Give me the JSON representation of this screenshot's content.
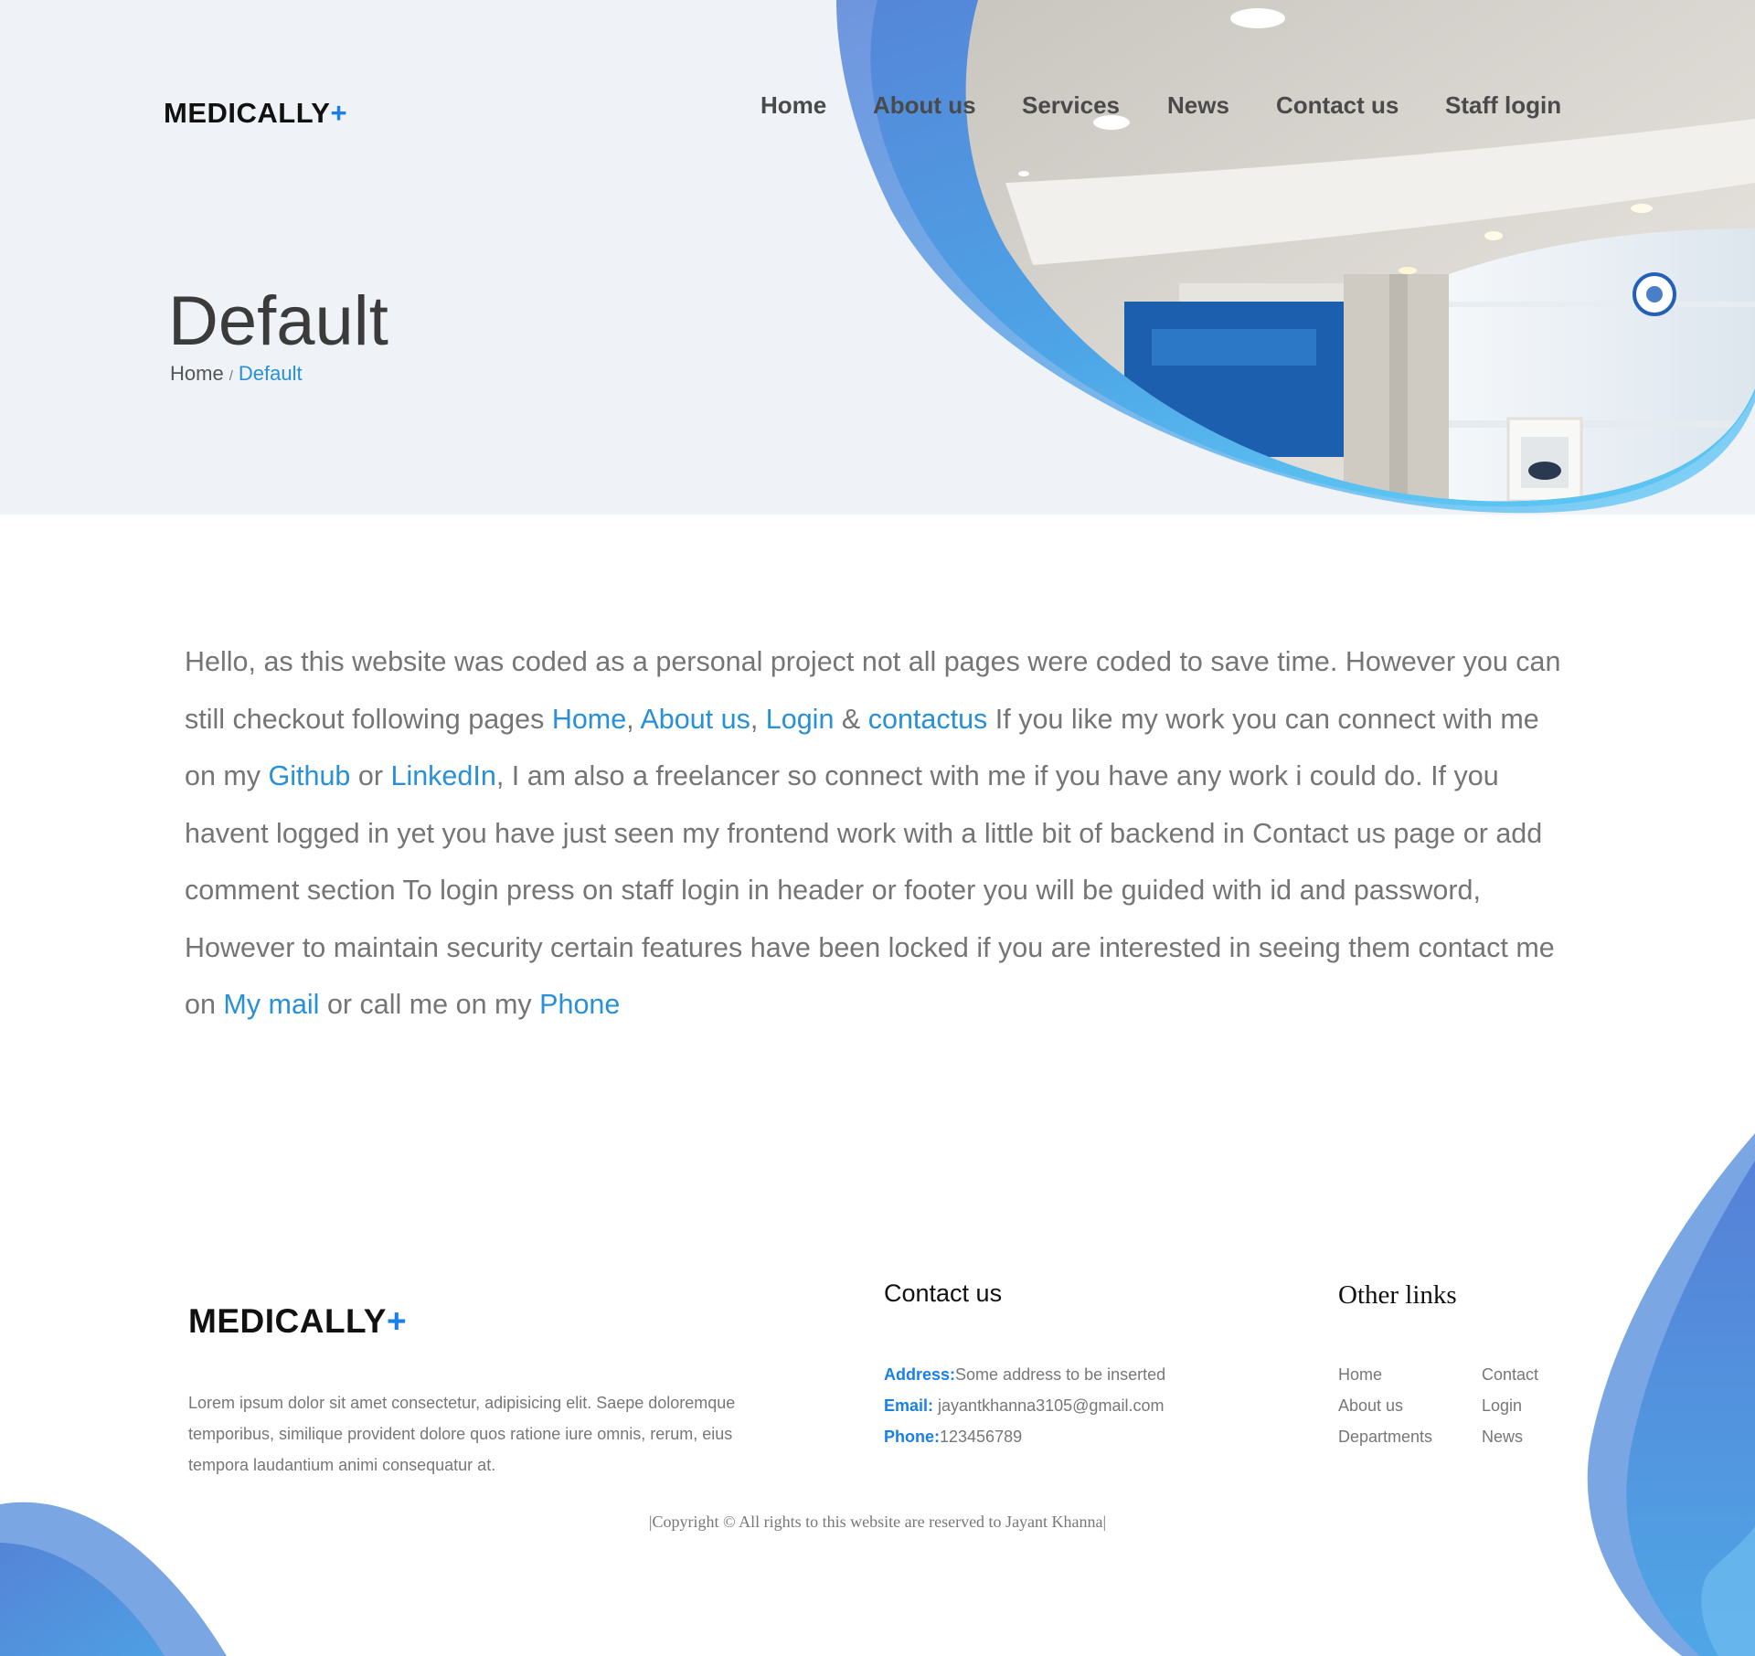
{
  "brand": {
    "name": "MEDICALLY",
    "plus": "+"
  },
  "nav": {
    "items": [
      {
        "label": "Home"
      },
      {
        "label": "About us"
      },
      {
        "label": "Services"
      },
      {
        "label": "News"
      },
      {
        "label": "Contact us"
      },
      {
        "label": "Staff login"
      }
    ]
  },
  "hero": {
    "title": "Default",
    "breadcrumb": {
      "home": "Home",
      "separator": "/",
      "current": "Default"
    }
  },
  "main": {
    "t1": "Hello, as this website was coded as a personal project not all pages were coded to save time. However you can still checkout following pages ",
    "link_home": "Home",
    "c1": ", ",
    "link_about": "About us",
    "c2": ", ",
    "link_login": "Login",
    "amp": " & ",
    "link_contactus": "contactus",
    "t2": " If you like my work you can connect with me on my ",
    "link_github": "Github",
    "or1": " or ",
    "link_linkedin": "LinkedIn",
    "t3": ", I am also a freelancer so connect with me if you have any work i could do. If you havent logged in yet you have just seen my frontend work with a little bit of backend in Contact us page or add comment section To login press on staff login in header or footer you will be guided with id and password, However to maintain security certain features have been locked if you are interested in seeing them contact me on ",
    "link_mail": "My mail",
    "t4": " or call me on my ",
    "link_phone": "Phone"
  },
  "footer": {
    "about": "Lorem ipsum dolor sit amet consectetur, adipisicing elit. Saepe doloremque temporibus, similique provident dolore quos ratione iure omnis, rerum, eius tempora laudantium animi consequatur at.",
    "contact_heading": "Contact us",
    "address_label": "Address:",
    "address_value": "Some address to be inserted",
    "email_label": "Email:",
    "email_value": " jayantkhanna3105@gmail.com",
    "phone_label": "Phone:",
    "phone_value": "123456789",
    "links_heading": "Other links",
    "links": [
      {
        "label": "Home"
      },
      {
        "label": "Contact"
      },
      {
        "label": "About us"
      },
      {
        "label": "Login"
      },
      {
        "label": "Departments"
      },
      {
        "label": "News"
      }
    ],
    "copyright": "|Copyright © All rights to this website are reserved to Jayant Khanna|"
  },
  "colors": {
    "accent": "#1a7fe8",
    "link": "#2890d8",
    "hero_bg": "#eff2f7",
    "wave_dark": "#4f7fd6",
    "wave_light": "#5ab6ee"
  },
  "icons": {
    "hero_image": "clinic-reception-photo",
    "wave": "blue-wave-decoration"
  }
}
